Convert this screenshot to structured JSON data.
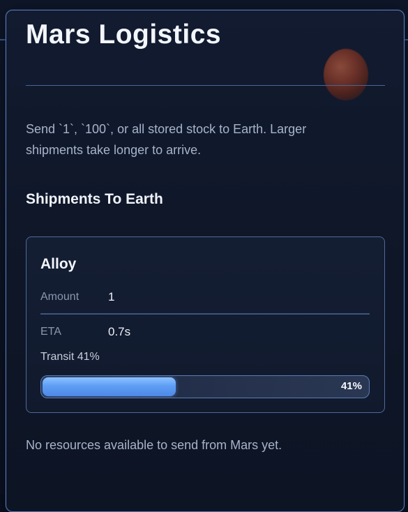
{
  "panel": {
    "title": "Mars Logistics",
    "description": "Send `1`, `100`, or all stored stock to Earth. Larger shipments take longer to arrive.",
    "planet_icon": "mars-planet-icon"
  },
  "shipments": {
    "heading": "Shipments To Earth",
    "items": [
      {
        "resource": "Alloy",
        "amount_label": "Amount",
        "amount_value": "1",
        "eta_label": "ETA",
        "eta_value": "0.7s",
        "transit_label": "Transit 41%",
        "progress_text": "41%",
        "progress_fraction": 0.41
      }
    ]
  },
  "empty_note": "No resources available to send from Mars yet.",
  "colors": {
    "accent": "#5f9ef5",
    "panel_border": "#5a7cb8",
    "background": "#0a1020"
  }
}
